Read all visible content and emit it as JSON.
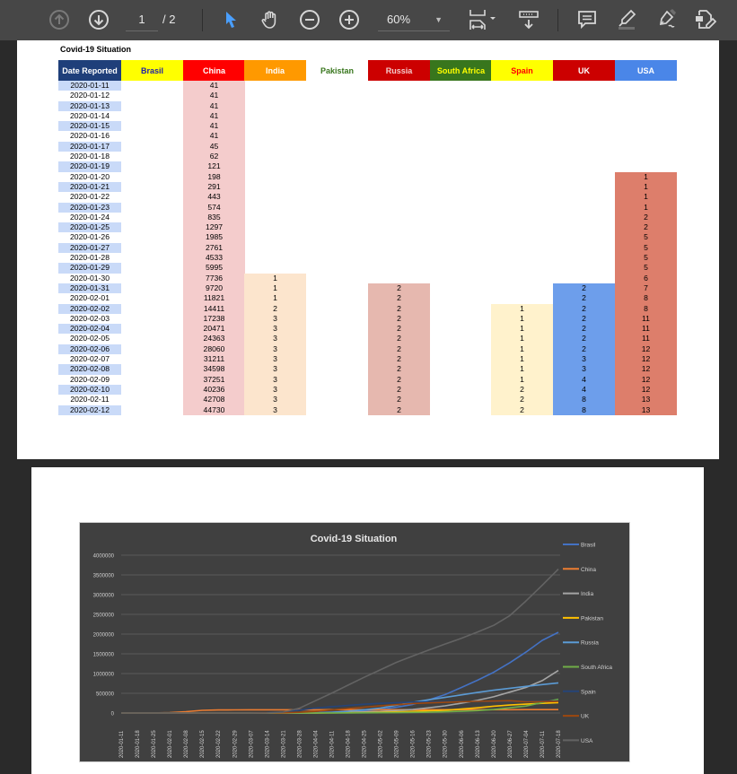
{
  "toolbar": {
    "page_current": "1",
    "page_total": "/ 2",
    "zoom_level": "60%",
    "icons": [
      "arrow-up-circle-icon",
      "arrow-down-circle-icon",
      "cursor-select-icon",
      "hand-pan-icon",
      "zoom-out-icon",
      "zoom-in-icon",
      "fit-width-icon",
      "scroll-mode-icon",
      "comment-icon",
      "highlight-icon",
      "sign-icon",
      "fill-form-icon"
    ]
  },
  "sheet": {
    "title": "Covid-19 Situation",
    "columns": [
      {
        "label": "Date Reported",
        "bg": "#1f3f7a",
        "fg": "#ffffff"
      },
      {
        "label": "Brasil",
        "bg": "#ffff00",
        "fg": "#1f1fa8"
      },
      {
        "label": "China",
        "bg": "#ff0000",
        "fg": "#ffffff"
      },
      {
        "label": "India",
        "bg": "#ff9900",
        "fg": "#ffffff"
      },
      {
        "label": "Pakistan",
        "bg": "#ffffff",
        "fg": "#38761d"
      },
      {
        "label": "Russia",
        "bg": "#cc0000",
        "fg": "#f4cccc"
      },
      {
        "label": "South Africa",
        "bg": "#38761d",
        "fg": "#ffff00"
      },
      {
        "label": "Spain",
        "bg": "#ffff00",
        "fg": "#ff0000"
      },
      {
        "label": "UK",
        "bg": "#cc0000",
        "fg": "#ffffff"
      },
      {
        "label": "USA",
        "bg": "#4a86e8",
        "fg": "#ffffff"
      }
    ],
    "dates": [
      "2020-01-11",
      "2020-01-12",
      "2020-01-13",
      "2020-01-14",
      "2020-01-15",
      "2020-01-16",
      "2020-01-17",
      "2020-01-18",
      "2020-01-19",
      "2020-01-20",
      "2020-01-21",
      "2020-01-22",
      "2020-01-23",
      "2020-01-24",
      "2020-01-25",
      "2020-01-26",
      "2020-01-27",
      "2020-01-28",
      "2020-01-29",
      "2020-01-30",
      "2020-01-31",
      "2020-02-01",
      "2020-02-02",
      "2020-02-03",
      "2020-02-04",
      "2020-02-05",
      "2020-02-06",
      "2020-02-07",
      "2020-02-08",
      "2020-02-09",
      "2020-02-10",
      "2020-02-11",
      "2020-02-12"
    ],
    "china": [
      "41",
      "41",
      "41",
      "41",
      "41",
      "41",
      "45",
      "62",
      "121",
      "198",
      "291",
      "443",
      "574",
      "835",
      "1297",
      "1985",
      "2761",
      "4533",
      "5995",
      "7736",
      "9720",
      "11821",
      "14411",
      "17238",
      "20471",
      "24363",
      "28060",
      "31211",
      "34598",
      "37251",
      "40236",
      "42708",
      "44730"
    ],
    "india": [
      "1",
      "1",
      "1",
      "2",
      "3",
      "3",
      "3",
      "3",
      "3",
      "3",
      "3",
      "3",
      "3",
      "3"
    ],
    "russia": [
      "2",
      "2",
      "2",
      "2",
      "2",
      "2",
      "2",
      "2",
      "2",
      "2",
      "2",
      "2",
      "2"
    ],
    "spain": [
      "1",
      "1",
      "1",
      "1",
      "1",
      "1",
      "1",
      "1",
      "2",
      "2",
      "2"
    ],
    "uk": [
      "2",
      "2",
      "2",
      "2",
      "2",
      "2",
      "2",
      "3",
      "3",
      "4",
      "4",
      "8",
      "8"
    ],
    "usa": [
      "1",
      "1",
      "1",
      "1",
      "2",
      "2",
      "5",
      "5",
      "5",
      "5",
      "6",
      "7",
      "8",
      "8",
      "11",
      "11",
      "11",
      "12",
      "12",
      "12",
      "12",
      "12",
      "13",
      "13"
    ],
    "cell_colors": {
      "date_alt": "#c9daf8",
      "china": "#f4cccc",
      "india": "#fce5cd",
      "russia": "#e6b8af",
      "spain": "#fff2cc",
      "uk": "#6d9eeb",
      "usa": "#dd7e6b"
    }
  },
  "chart_data": {
    "type": "line",
    "title": "Covid-19 Situation",
    "xlabel": "",
    "ylabel": "",
    "ylim": [
      0,
      4000000
    ],
    "yticks": [
      "0",
      "500000",
      "1000000",
      "1500000",
      "2000000",
      "2500000",
      "3000000",
      "3500000",
      "4000000"
    ],
    "grid": true,
    "legend": "right",
    "x": [
      "2020-01-11",
      "2020-01-18",
      "2020-01-25",
      "2020-02-01",
      "2020-02-08",
      "2020-02-15",
      "2020-02-22",
      "2020-02-29",
      "2020-03-07",
      "2020-03-14",
      "2020-03-21",
      "2020-03-28",
      "2020-04-04",
      "2020-04-11",
      "2020-04-18",
      "2020-04-25",
      "2020-05-02",
      "2020-05-09",
      "2020-05-16",
      "2020-05-23",
      "2020-05-30",
      "2020-06-06",
      "2020-06-13",
      "2020-06-20",
      "2020-06-27",
      "2020-07-04",
      "2020-07-11",
      "2020-07-18"
    ],
    "series": [
      {
        "name": "Brasil",
        "color": "#4472c4",
        "values": [
          0,
          0,
          0,
          0,
          0,
          0,
          0,
          1,
          19,
          121,
          1021,
          3417,
          10278,
          19638,
          33682,
          52995,
          91589,
          145328,
          218223,
          330890,
          465166,
          645771,
          828810,
          1032913,
          1274974,
          1543341,
          1839850,
          2046328
        ]
      },
      {
        "name": "China",
        "color": "#ed7d31",
        "values": [
          41,
          121,
          1985,
          11821,
          34598,
          68413,
          76936,
          79394,
          80813,
          81003,
          81416,
          82149,
          82875,
          83134,
          84149,
          84338,
          84387,
          84451,
          84484,
          84525,
          84553,
          84602,
          84903,
          85013,
          85190,
          85306,
          85568,
          85780
        ]
      },
      {
        "name": "India",
        "color": "#a5a5a5",
        "values": [
          0,
          0,
          0,
          1,
          3,
          3,
          3,
          3,
          31,
          84,
          283,
          918,
          3072,
          8447,
          15712,
          26496,
          39980,
          62808,
          90927,
          131868,
          182143,
          246628,
          320922,
          410461,
          528859,
          648315,
          820916,
          1077781
        ]
      },
      {
        "name": "Pakistan",
        "color": "#ffc000",
        "values": [
          0,
          0,
          0,
          0,
          0,
          0,
          0,
          2,
          6,
          28,
          645,
          1408,
          2880,
          4892,
          7993,
          12227,
          18114,
          28736,
          40151,
          54601,
          69496,
          98943,
          132405,
          171666,
          202955,
          225283,
          246351,
          263496
        ]
      },
      {
        "name": "Russia",
        "color": "#5b9bd5",
        "values": [
          0,
          0,
          0,
          2,
          2,
          2,
          2,
          2,
          14,
          63,
          306,
          1264,
          5389,
          15770,
          42853,
          80949,
          124054,
          198676,
          272043,
          335882,
          396575,
          458689,
          520129,
          576952,
          627646,
          674515,
          720547,
          764215
        ]
      },
      {
        "name": "South Africa",
        "color": "#70ad47",
        "values": [
          0,
          0,
          0,
          0,
          0,
          0,
          0,
          0,
          2,
          38,
          240,
          1187,
          1585,
          2028,
          3034,
          4546,
          6783,
          10015,
          15515,
          21343,
          32683,
          43434,
          61927,
          87715,
          131800,
          177124,
          264184,
          350879
        ]
      },
      {
        "name": "Spain",
        "color": "#264478",
        "values": [
          0,
          0,
          0,
          0,
          1,
          2,
          2,
          45,
          400,
          5753,
          24926,
          72248,
          124736,
          161852,
          191726,
          223759,
          245567,
          260117,
          276505,
          282852,
          286509,
          288630,
          291008,
          293018,
          295549,
          297183,
          300988,
          307335
        ]
      },
      {
        "name": "UK",
        "color": "#9e480e",
        "values": [
          0,
          0,
          0,
          2,
          3,
          9,
          13,
          23,
          206,
          1140,
          5018,
          17089,
          41903,
          78991,
          114217,
          148377,
          182260,
          211364,
          240161,
          257154,
          271222,
          284868,
          294375,
          302834,
          310250,
          284276,
          288953,
          294792
        ]
      },
      {
        "name": "USA",
        "color": "#636363",
        "values": [
          0,
          0,
          2,
          8,
          12,
          15,
          35,
          68,
          402,
          2727,
          23718,
          120204,
          311357,
          501615,
          704297,
          905333,
          1093880,
          1283929,
          1442824,
          1595885,
          1747087,
          1891690,
          2048986,
          2220961,
          2467837,
          2839542,
          3236130,
          3647715
        ]
      }
    ]
  }
}
